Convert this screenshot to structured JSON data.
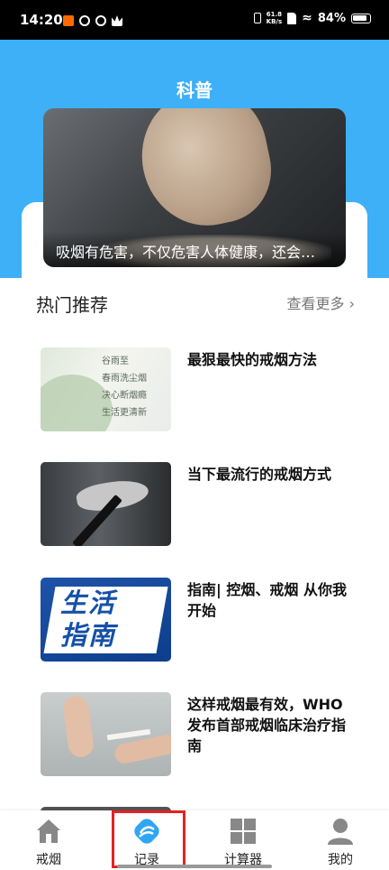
{
  "status_bar": {
    "time": "14:20",
    "net_speed_value": "61.8",
    "net_speed_unit": "KB/s",
    "battery": "84%"
  },
  "header": {
    "title": "科普"
  },
  "banner": {
    "caption": "吸烟有危害，不仅危害人体健康，还会…"
  },
  "section": {
    "title": "热门推荐",
    "see_more": "查看更多 ›"
  },
  "articles": [
    {
      "title": "最狠最快的戒烟方法",
      "thumb_text": [
        "谷雨至",
        "春雨洗尘烟",
        "决心断烟瘾",
        "生活更清新"
      ]
    },
    {
      "title": "当下最流行的戒烟方式"
    },
    {
      "title": "指南| 控烟、戒烟 从你我开始",
      "thumb_text": [
        "生活",
        "指南"
      ]
    },
    {
      "title": "这样戒烟最有效，WHO发布首部戒烟临床治疗指南"
    }
  ],
  "bottom_nav": [
    {
      "label": "戒烟",
      "icon": "home-icon"
    },
    {
      "label": "记录",
      "icon": "record-icon",
      "active": true
    },
    {
      "label": "计算器",
      "icon": "grid-icon"
    },
    {
      "label": "我的",
      "icon": "user-icon"
    }
  ],
  "colors": {
    "brand": "#3db0f7",
    "highlight": "#e52222"
  }
}
